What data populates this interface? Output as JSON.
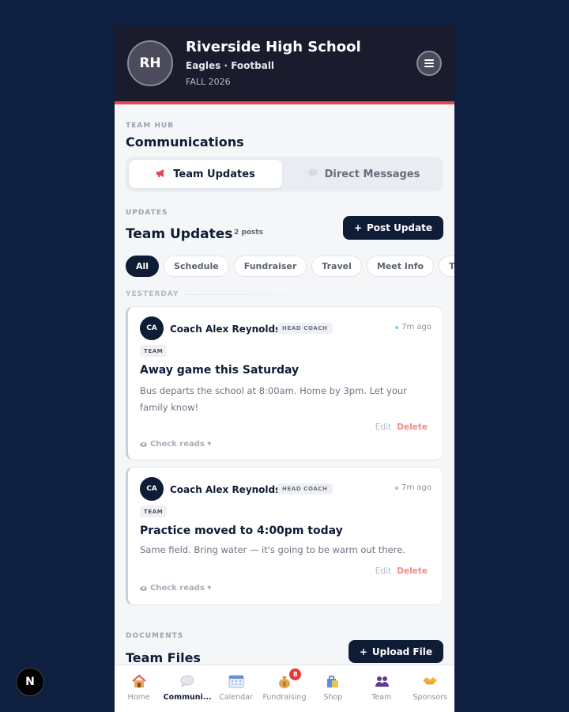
{
  "header": {
    "avatar_initials": "RH",
    "school_name": "Riverside High School",
    "team_line": "Eagles · Football",
    "season": "FALL 2026"
  },
  "hub": {
    "eyebrow": "TEAM HUB",
    "title": "Communications"
  },
  "segments": [
    {
      "label": "Team Updates",
      "icon": "megaphone-icon",
      "active": true
    },
    {
      "label": "Direct Messages",
      "icon": "speech-bubble-icon",
      "active": false
    }
  ],
  "updates": {
    "eyebrow": "UPDATES",
    "title": "Team Updates",
    "count": "2 posts",
    "post_button": "Post Update",
    "post_button_icon": "+"
  },
  "filters": [
    "All",
    "Schedule",
    "Fundraiser",
    "Travel",
    "Meet Info",
    "Team"
  ],
  "day_label": "YESTERDAY",
  "posts": [
    {
      "author_initials": "CA",
      "author": "Coach Alex Reynolds",
      "role": "HEAD COACH",
      "time": "7m ago",
      "tag": "TEAM",
      "title": "Away game this Saturday",
      "body": "Bus departs the school at 8:00am. Home by 3pm. Let your family know!",
      "edit": "Edit",
      "delete": "Delete",
      "reads": "Check reads ▾"
    },
    {
      "author_initials": "CA",
      "author": "Coach Alex Reynolds",
      "role": "HEAD COACH",
      "time": "7m ago",
      "tag": "TEAM",
      "title": "Practice moved to 4:00pm today",
      "body": "Same field. Bring water — it's going to be warm out there.",
      "edit": "Edit",
      "delete": "Delete",
      "reads": "Check reads ▾"
    }
  ],
  "documents": {
    "eyebrow": "DOCUMENTS",
    "title": "Team Files",
    "upload_button": "Upload File",
    "upload_button_icon": "+"
  },
  "tabs": [
    {
      "label": "Home",
      "icon": "house-icon",
      "active": false
    },
    {
      "label": "Communi...",
      "icon": "speech-bubble-icon",
      "active": true
    },
    {
      "label": "Calendar",
      "icon": "calendar-icon",
      "active": false
    },
    {
      "label": "Fundraising",
      "icon": "money-bag-icon",
      "active": false,
      "badge": "8"
    },
    {
      "label": "Shop",
      "icon": "shopping-bag-icon",
      "active": false
    },
    {
      "label": "Team",
      "icon": "people-icon",
      "active": false
    },
    {
      "label": "Sponsors",
      "icon": "handshake-icon",
      "active": false
    }
  ],
  "dev_indicator": "N",
  "colors": {
    "page_bg": "#0f1f3f",
    "header_bg": "#1b1b2e",
    "accent": "#e4475a",
    "navy": "#0f1c35",
    "delete": "#f08a86"
  }
}
